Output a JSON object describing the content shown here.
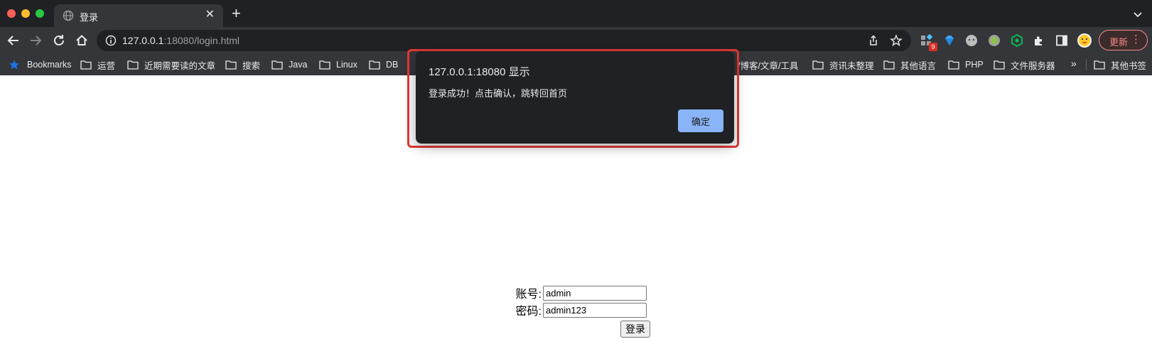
{
  "tab": {
    "title": "登录",
    "close": "✕",
    "new_tab": "+"
  },
  "address_bar": {
    "host": "127.0.0.1",
    "rest": ":18080/login.html"
  },
  "toolbar": {
    "extension_badge": "9",
    "update_label": "更新",
    "menu_dots": "⋮"
  },
  "bookmarks": [
    {
      "label": "Bookmarks",
      "icon": "star-icon"
    },
    {
      "label": "运营",
      "icon": "folder-icon"
    },
    {
      "label": "近期需要读的文章",
      "icon": "folder-icon"
    },
    {
      "label": "搜索",
      "icon": "folder-icon"
    },
    {
      "label": "Java",
      "icon": "folder-icon"
    },
    {
      "label": "Linux",
      "icon": "folder-icon"
    },
    {
      "label": "DB",
      "icon": "folder-icon"
    },
    {
      "label": "/博客/文章/工具",
      "icon": "folder-icon"
    },
    {
      "label": "资讯未整理",
      "icon": "folder-icon"
    },
    {
      "label": "其他语言",
      "icon": "folder-icon"
    },
    {
      "label": "PHP",
      "icon": "folder-icon"
    },
    {
      "label": "文件服务器",
      "icon": "folder-icon"
    }
  ],
  "bookmarks_overflow": "»",
  "other_bookmarks": "其他书签",
  "dialog": {
    "title": "127.0.0.1:18080 显示",
    "message": "登录成功！点击确认，跳转回首页",
    "ok_label": "确定"
  },
  "login_form": {
    "account_label": "账号:",
    "account_value": "admin",
    "password_label": "密码:",
    "password_value": "admin123",
    "submit_label": "登录"
  },
  "colors": {
    "chrome_dark": "#202124",
    "chrome_toolbar": "#35363a",
    "dialog_button": "#8ab4f8",
    "highlight": "#e53935"
  }
}
